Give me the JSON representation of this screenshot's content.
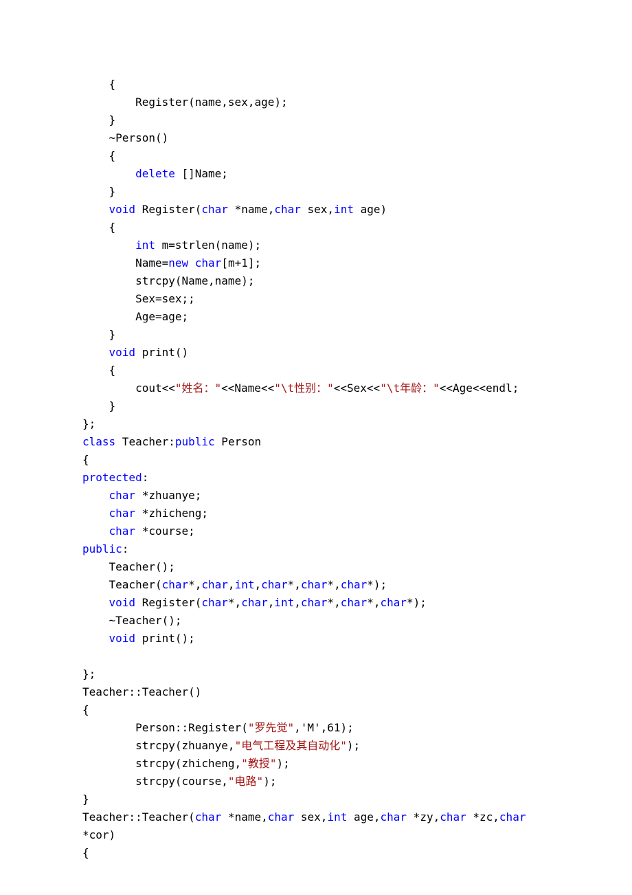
{
  "code": {
    "lines": [
      {
        "indent": 1,
        "segs": [
          {
            "t": "{"
          }
        ]
      },
      {
        "indent": 2,
        "segs": [
          {
            "t": "Register(name,sex,age);"
          }
        ]
      },
      {
        "indent": 1,
        "segs": [
          {
            "t": "}"
          }
        ]
      },
      {
        "indent": 1,
        "segs": [
          {
            "t": "~Person()"
          }
        ]
      },
      {
        "indent": 1,
        "segs": [
          {
            "t": "{"
          }
        ]
      },
      {
        "indent": 2,
        "segs": [
          {
            "t": "delete",
            "cls": "kw"
          },
          {
            "t": " []Name;"
          }
        ]
      },
      {
        "indent": 1,
        "segs": [
          {
            "t": "}"
          }
        ]
      },
      {
        "indent": 1,
        "segs": [
          {
            "t": "void",
            "cls": "kw"
          },
          {
            "t": " Register("
          },
          {
            "t": "char",
            "cls": "kw"
          },
          {
            "t": " *name,"
          },
          {
            "t": "char",
            "cls": "kw"
          },
          {
            "t": " sex,"
          },
          {
            "t": "int",
            "cls": "kw"
          },
          {
            "t": " age)"
          }
        ]
      },
      {
        "indent": 1,
        "segs": [
          {
            "t": "{"
          }
        ]
      },
      {
        "indent": 2,
        "segs": [
          {
            "t": "int",
            "cls": "kw"
          },
          {
            "t": " m=strlen(name);"
          }
        ]
      },
      {
        "indent": 2,
        "segs": [
          {
            "t": "Name="
          },
          {
            "t": "new",
            "cls": "kw"
          },
          {
            "t": " "
          },
          {
            "t": "char",
            "cls": "kw"
          },
          {
            "t": "[m+1];"
          }
        ]
      },
      {
        "indent": 2,
        "segs": [
          {
            "t": "strcpy(Name,name);"
          }
        ]
      },
      {
        "indent": 2,
        "segs": [
          {
            "t": "Sex=sex;;"
          }
        ]
      },
      {
        "indent": 2,
        "segs": [
          {
            "t": "Age=age;"
          }
        ]
      },
      {
        "indent": 1,
        "segs": [
          {
            "t": "}"
          }
        ]
      },
      {
        "indent": 1,
        "segs": [
          {
            "t": "void",
            "cls": "kw"
          },
          {
            "t": " print()"
          }
        ]
      },
      {
        "indent": 1,
        "segs": [
          {
            "t": "{"
          }
        ]
      },
      {
        "indent": 2,
        "segs": [
          {
            "t": "cout<<"
          },
          {
            "t": "\"姓名：\"",
            "cls": "str"
          },
          {
            "t": "<<Name<<"
          },
          {
            "t": "\"\\t性别：\"",
            "cls": "str"
          },
          {
            "t": "<<Sex<<"
          },
          {
            "t": "\"\\t年龄：\"",
            "cls": "str"
          },
          {
            "t": "<<Age<<endl;"
          }
        ]
      },
      {
        "indent": 1,
        "segs": [
          {
            "t": "}"
          }
        ]
      },
      {
        "indent": 0,
        "segs": [
          {
            "t": "};"
          }
        ]
      },
      {
        "indent": 0,
        "segs": [
          {
            "t": "class",
            "cls": "kw"
          },
          {
            "t": " Teacher:"
          },
          {
            "t": "public",
            "cls": "kw"
          },
          {
            "t": " Person"
          }
        ]
      },
      {
        "indent": 0,
        "segs": [
          {
            "t": "{"
          }
        ]
      },
      {
        "indent": 0,
        "segs": [
          {
            "t": "protected",
            "cls": "kw"
          },
          {
            "t": ":"
          }
        ]
      },
      {
        "indent": 1,
        "segs": [
          {
            "t": "char",
            "cls": "kw"
          },
          {
            "t": " *zhuanye;"
          }
        ]
      },
      {
        "indent": 1,
        "segs": [
          {
            "t": "char",
            "cls": "kw"
          },
          {
            "t": " *zhicheng;"
          }
        ]
      },
      {
        "indent": 1,
        "segs": [
          {
            "t": "char",
            "cls": "kw"
          },
          {
            "t": " *course;"
          }
        ]
      },
      {
        "indent": 0,
        "segs": [
          {
            "t": "public",
            "cls": "kw"
          },
          {
            "t": ":"
          }
        ]
      },
      {
        "indent": 1,
        "segs": [
          {
            "t": "Teacher();"
          }
        ]
      },
      {
        "indent": 1,
        "segs": [
          {
            "t": "Teacher("
          },
          {
            "t": "char",
            "cls": "kw"
          },
          {
            "t": "*,"
          },
          {
            "t": "char",
            "cls": "kw"
          },
          {
            "t": ","
          },
          {
            "t": "int",
            "cls": "kw"
          },
          {
            "t": ","
          },
          {
            "t": "char",
            "cls": "kw"
          },
          {
            "t": "*,"
          },
          {
            "t": "char",
            "cls": "kw"
          },
          {
            "t": "*,"
          },
          {
            "t": "char",
            "cls": "kw"
          },
          {
            "t": "*);"
          }
        ]
      },
      {
        "indent": 1,
        "segs": [
          {
            "t": "void",
            "cls": "kw"
          },
          {
            "t": " Register("
          },
          {
            "t": "char",
            "cls": "kw"
          },
          {
            "t": "*,"
          },
          {
            "t": "char",
            "cls": "kw"
          },
          {
            "t": ","
          },
          {
            "t": "int",
            "cls": "kw"
          },
          {
            "t": ","
          },
          {
            "t": "char",
            "cls": "kw"
          },
          {
            "t": "*,"
          },
          {
            "t": "char",
            "cls": "kw"
          },
          {
            "t": "*,"
          },
          {
            "t": "char",
            "cls": "kw"
          },
          {
            "t": "*);"
          }
        ]
      },
      {
        "indent": 1,
        "segs": [
          {
            "t": "~Teacher();"
          }
        ]
      },
      {
        "indent": 1,
        "segs": [
          {
            "t": "void",
            "cls": "kw"
          },
          {
            "t": " print();"
          }
        ]
      },
      {
        "indent": 0,
        "segs": [
          {
            "t": ""
          }
        ]
      },
      {
        "indent": 0,
        "segs": [
          {
            "t": "};"
          }
        ]
      },
      {
        "indent": 0,
        "segs": [
          {
            "t": "Teacher::Teacher()"
          }
        ]
      },
      {
        "indent": 0,
        "segs": [
          {
            "t": "{"
          }
        ]
      },
      {
        "indent": 2,
        "segs": [
          {
            "t": "Person::Register("
          },
          {
            "t": "\"罗先觉\"",
            "cls": "str"
          },
          {
            "t": ",'M',61);"
          }
        ]
      },
      {
        "indent": 2,
        "segs": [
          {
            "t": "strcpy(zhuanye,"
          },
          {
            "t": "\"电气工程及其自动化\"",
            "cls": "str"
          },
          {
            "t": ");"
          }
        ]
      },
      {
        "indent": 2,
        "segs": [
          {
            "t": "strcpy(zhicheng,"
          },
          {
            "t": "\"教授\"",
            "cls": "str"
          },
          {
            "t": ");"
          }
        ]
      },
      {
        "indent": 2,
        "segs": [
          {
            "t": "strcpy(course,"
          },
          {
            "t": "\"电路\"",
            "cls": "str"
          },
          {
            "t": ");"
          }
        ]
      },
      {
        "indent": 0,
        "segs": [
          {
            "t": "}"
          }
        ]
      },
      {
        "indent": 0,
        "segs": [
          {
            "t": "Teacher::Teacher("
          },
          {
            "t": "char",
            "cls": "kw"
          },
          {
            "t": " *name,"
          },
          {
            "t": "char",
            "cls": "kw"
          },
          {
            "t": " sex,"
          },
          {
            "t": "int",
            "cls": "kw"
          },
          {
            "t": " age,"
          },
          {
            "t": "char",
            "cls": "kw"
          },
          {
            "t": " *zy,"
          },
          {
            "t": "char",
            "cls": "kw"
          },
          {
            "t": " *zc,"
          },
          {
            "t": "char",
            "cls": "kw"
          }
        ]
      },
      {
        "indent": 0,
        "segs": [
          {
            "t": "*cor)"
          }
        ]
      },
      {
        "indent": 0,
        "segs": [
          {
            "t": "{"
          }
        ]
      }
    ],
    "indentUnit": "    "
  }
}
